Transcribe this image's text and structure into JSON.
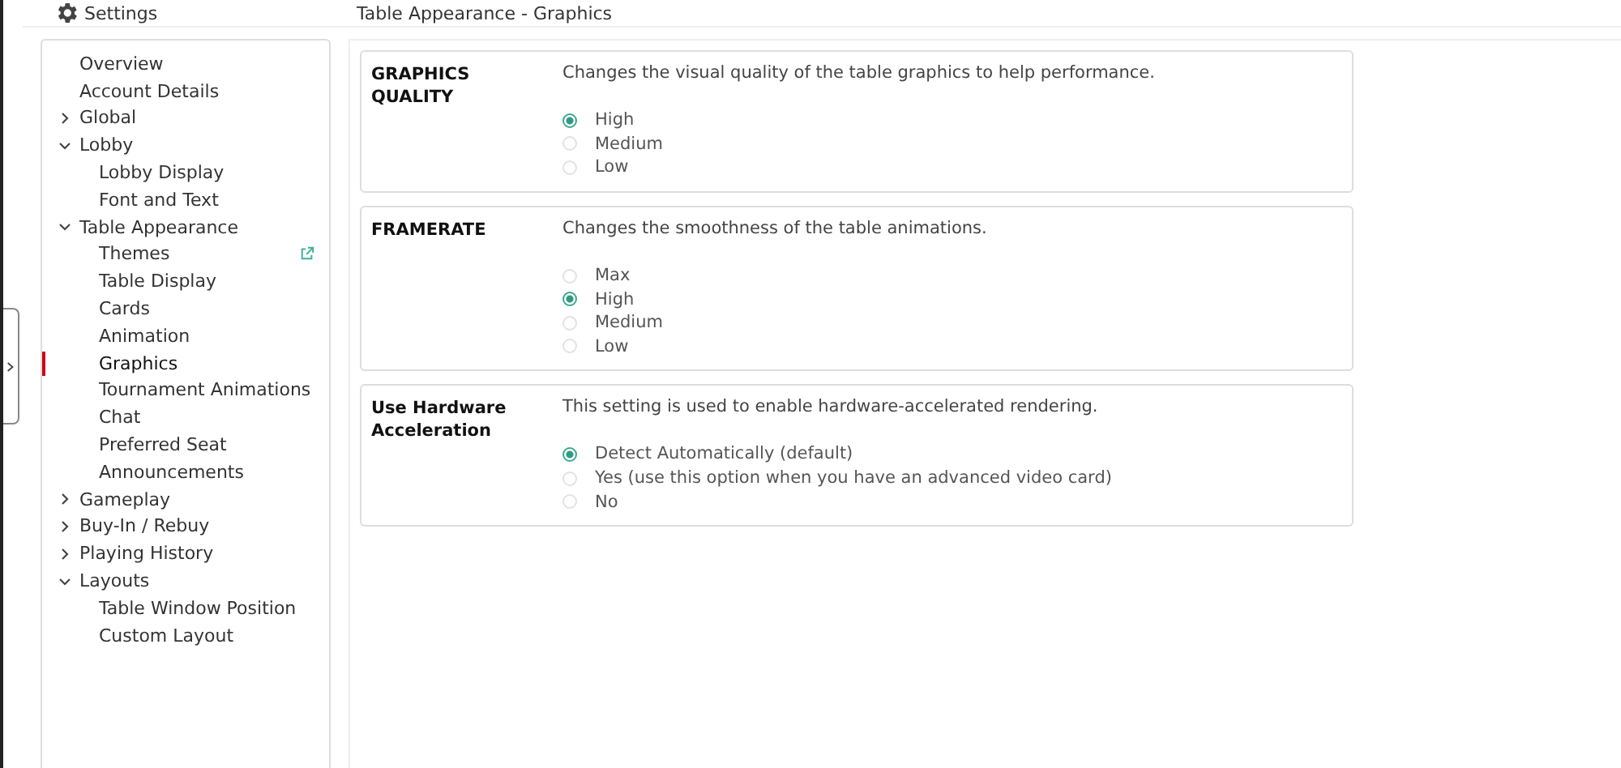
{
  "header": {
    "title": "Settings",
    "page_title": "Table Appearance - Graphics"
  },
  "sidebar": {
    "items": [
      {
        "label": "Overview",
        "selected": false
      },
      {
        "label": "Account Details",
        "selected": false
      },
      {
        "label": "Global",
        "selected": false,
        "expanded": false
      },
      {
        "label": "Lobby",
        "selected": false,
        "expanded": true,
        "children": [
          {
            "label": "Lobby Display",
            "selected": false
          },
          {
            "label": "Font and Text",
            "selected": false
          }
        ]
      },
      {
        "label": "Table Appearance",
        "selected": false,
        "expanded": true,
        "children": [
          {
            "label": "Themes",
            "selected": false,
            "external": true
          },
          {
            "label": "Table Display",
            "selected": false
          },
          {
            "label": "Cards",
            "selected": false
          },
          {
            "label": "Animation",
            "selected": false
          },
          {
            "label": "Graphics",
            "selected": true
          },
          {
            "label": "Tournament Animations",
            "selected": false
          },
          {
            "label": "Chat",
            "selected": false
          },
          {
            "label": "Preferred Seat",
            "selected": false
          },
          {
            "label": "Announcements",
            "selected": false
          }
        ]
      },
      {
        "label": "Gameplay",
        "selected": false,
        "expanded": false
      },
      {
        "label": "Buy-In / Rebuy",
        "selected": false,
        "expanded": false
      },
      {
        "label": "Playing History",
        "selected": false,
        "expanded": false
      },
      {
        "label": "Layouts",
        "selected": false,
        "expanded": true,
        "children": [
          {
            "label": "Table Window Position",
            "selected": false
          },
          {
            "label": "Custom Layout",
            "selected": false
          }
        ]
      }
    ]
  },
  "sections": [
    {
      "title": "GRAPHICS QUALITY",
      "description": "Changes the visual quality of the table graphics to help performance.",
      "options": [
        {
          "label": "High",
          "selected": true
        },
        {
          "label": "Medium",
          "selected": false
        },
        {
          "label": "Low",
          "selected": false
        }
      ]
    },
    {
      "title": "FRAMERATE",
      "description": "Changes the smoothness of the table animations.",
      "options": [
        {
          "label": "Max",
          "selected": false
        },
        {
          "label": "High",
          "selected": true
        },
        {
          "label": "Medium",
          "selected": false
        },
        {
          "label": "Low",
          "selected": false
        }
      ]
    },
    {
      "title": "Use Hardware Acceleration",
      "description": "This setting is used to enable hardware-accelerated rendering.",
      "options": [
        {
          "label": "Detect Automatically (default)",
          "selected": true
        },
        {
          "label": "Yes (use this option when you have an advanced video card)",
          "selected": false
        },
        {
          "label": "No",
          "selected": false
        }
      ]
    }
  ]
}
